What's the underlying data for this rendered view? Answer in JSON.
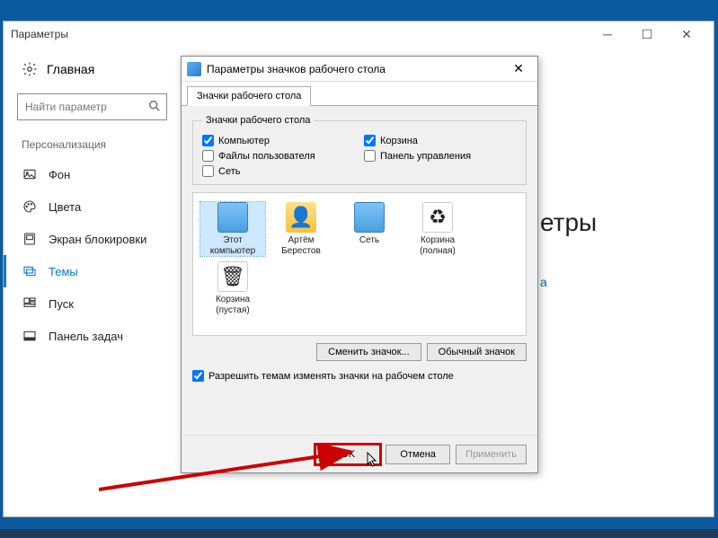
{
  "settings": {
    "window_title": "Параметры",
    "home_label": "Главная",
    "search_placeholder": "Найти параметр",
    "section_label": "Персонализация",
    "items": [
      {
        "label": "Фон"
      },
      {
        "label": "Цвета"
      },
      {
        "label": "Экран блокировки"
      },
      {
        "label": "Темы"
      },
      {
        "label": "Пуск"
      },
      {
        "label": "Панель задач"
      }
    ]
  },
  "main": {
    "partial_heading": "етры",
    "link_fragment": "а"
  },
  "dialog": {
    "title": "Параметры значков рабочего стола",
    "tab_label": "Значки рабочего стола",
    "group_label": "Значки рабочего стола",
    "checkboxes": {
      "computer": {
        "label": "Компьютер",
        "checked": true
      },
      "recycle": {
        "label": "Корзина",
        "checked": true
      },
      "userfiles": {
        "label": "Файлы пользователя",
        "checked": false
      },
      "controlpanel": {
        "label": "Панель управления",
        "checked": false
      },
      "network": {
        "label": "Сеть",
        "checked": false
      }
    },
    "icons": [
      {
        "label": "Этот компьютер",
        "type": "monitor"
      },
      {
        "label": "Артём Берестов",
        "type": "folder"
      },
      {
        "label": "Сеть",
        "type": "monitor"
      },
      {
        "label": "Корзина (полная)",
        "type": "bin"
      },
      {
        "label": "Корзина (пустая)",
        "type": "bin"
      }
    ],
    "change_icon_btn": "Сменить значок...",
    "default_icon_btn": "Обычный значок",
    "allow_themes_label": "Разрешить темам изменять значки на рабочем столе",
    "allow_themes_checked": true,
    "ok_btn": "OK",
    "cancel_btn": "Отмена",
    "apply_btn": "Применить"
  }
}
